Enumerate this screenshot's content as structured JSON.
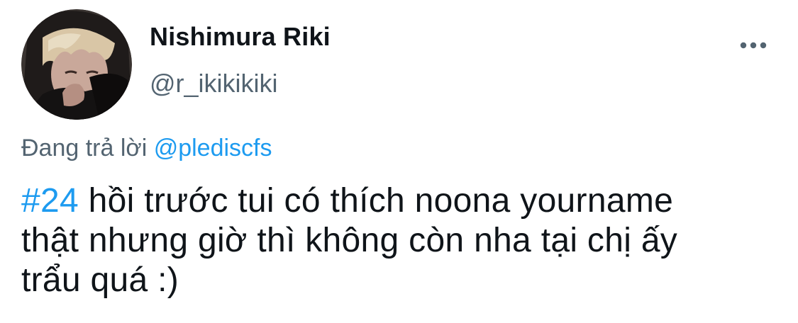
{
  "author": {
    "display_name": "Nishimura Riki",
    "handle": "@r_ikikikiki",
    "avatar_icon": "profile-photo-avatar"
  },
  "menu": {
    "more_icon": "more-horizontal-icon"
  },
  "reply": {
    "prefix": "Đang trả lời ",
    "mention": "@plediscfs"
  },
  "tweet": {
    "hashtag": "#24",
    "line1_rest": " hồi trước tui có thích noona yourname",
    "line2": "thật nhưng giờ thì không còn nha tại chị ấy",
    "line3": "trẩu quá :)"
  },
  "colors": {
    "link": "#1d9bf0",
    "secondary_text": "#536471",
    "primary_text": "#0f1419"
  }
}
